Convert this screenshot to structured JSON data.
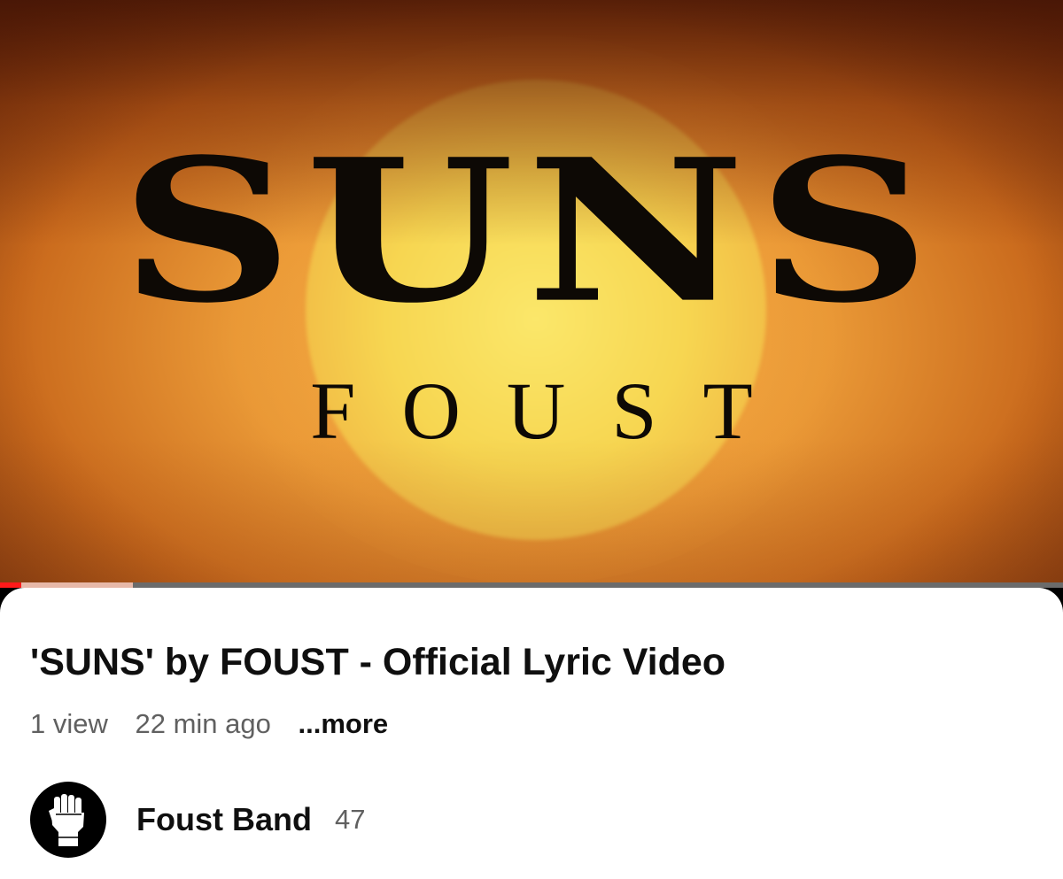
{
  "video": {
    "frame_title": "SUNS",
    "frame_subtitle": "FOUST",
    "progress_played": 0.02,
    "progress_buffered": 0.125,
    "colors": {
      "sun": "#f7d651",
      "sky": "#e99836",
      "text": "#0d0905",
      "progress_played": "#ff1a1a"
    }
  },
  "details": {
    "title": "'SUNS' by FOUST - Official Lyric Video",
    "views": "1 view",
    "age": "22 min ago",
    "more_label": "...more"
  },
  "channel": {
    "name": "Foust Band",
    "subscribers": "47",
    "avatar_icon": "raised-fist-icon"
  }
}
